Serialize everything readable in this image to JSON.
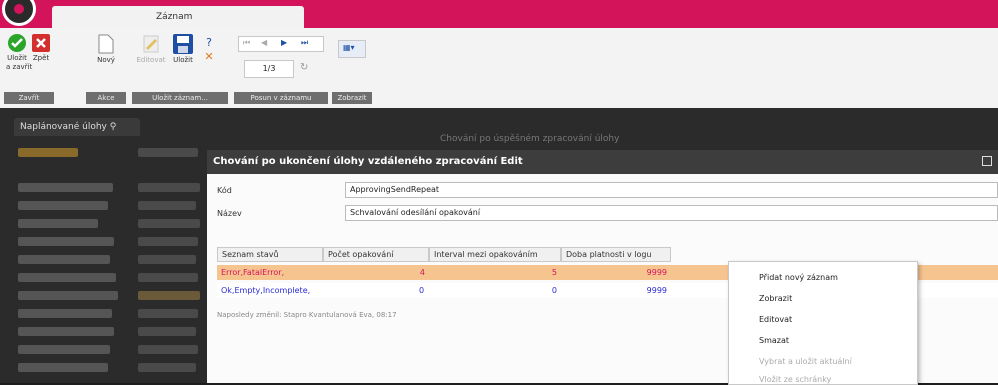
{
  "ribbon_tab": "Záznam",
  "ribbon": {
    "save_close_label": "Uložit\na zavřít",
    "back_label": "Zpět",
    "new_label": "Nový",
    "edit_label": "Editovat",
    "save_label": "Uložit",
    "help_label": "?",
    "page_indicator": "1/3",
    "groups": [
      "Zavřít",
      "Akce",
      "Uložit záznam...",
      "Posun v záznamu",
      "Zobrazit"
    ]
  },
  "doc_tab": "Naplánované úlohy",
  "background_title": "Chování po úspěšném zpracování úlohy",
  "dialog": {
    "title": "Chování po ukončení úlohy vzdáleného zpracování Edit",
    "code_label": "Kód",
    "code_value": "ApprovingSendRepeat",
    "name_label": "Název",
    "name_value": "Schvalování odesílání opakování",
    "grid": {
      "headers": [
        "Seznam stavů",
        "Počet opakování",
        "Interval mezi opakováním",
        "Doba platnosti v logu"
      ],
      "rows": [
        {
          "states": "Error,FatalError,",
          "count": "4",
          "interval": "5",
          "validity": "9999"
        },
        {
          "states": "Ok,Empty,Incomplete,",
          "count": "0",
          "interval": "0",
          "validity": "9999"
        }
      ]
    },
    "status_line": "Naposledy změnil: Stapro Kvantulanová Eva, 08:17"
  },
  "context_menu": {
    "items": [
      "Přidat nový záznam",
      "Zobrazit",
      "Editovat",
      "Smazat",
      "Vybrat a uložit aktuální",
      "Vložit ze schránky"
    ]
  },
  "colors": {
    "brand": "#d4145a",
    "row_highlight": "#f6c48f",
    "link": "#2b2bd6"
  }
}
